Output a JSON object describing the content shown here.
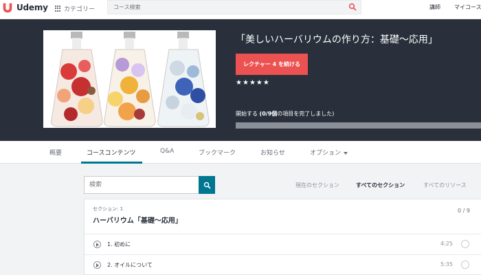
{
  "topbar": {
    "brand": "Udemy",
    "category_label": "カテゴリー",
    "search_placeholder": "コース検索",
    "instructor_label": "講師",
    "my_courses_label": "マイコース"
  },
  "hero": {
    "course_title": "「美しいハーバリウムの作り方：基礎〜応用」",
    "cta_label": "レクチャー 4 を続ける",
    "rating_stars": 5,
    "progress_prefix": "開始する ",
    "progress_detail": "(0/9個",
    "progress_suffix": "の項目を完了しました)",
    "progress_fraction": 0
  },
  "tabs": [
    {
      "label": "概要"
    },
    {
      "label": "コースコンテンツ"
    },
    {
      "label": "Q&A"
    },
    {
      "label": "ブックマーク"
    },
    {
      "label": "お知らせ"
    },
    {
      "label": "オプション"
    }
  ],
  "content": {
    "search_placeholder": "検索",
    "filters": [
      {
        "label": "現在のセクション"
      },
      {
        "label": "すべてのセクション"
      },
      {
        "label": "すべてのリソース"
      }
    ],
    "section": {
      "number_label": "セクション: 1",
      "title": "ハーバリウム「基礎〜応用」",
      "count": "0 / 9",
      "lectures": [
        {
          "title": "1.  初めに",
          "duration": "4:25"
        },
        {
          "title": "2.  オイルについて",
          "duration": "5:35"
        }
      ]
    }
  },
  "colors": {
    "brand_red": "#ec5252",
    "hero_bg": "#29303b",
    "accent_teal": "#007791",
    "star_gold": "#f4c150"
  }
}
